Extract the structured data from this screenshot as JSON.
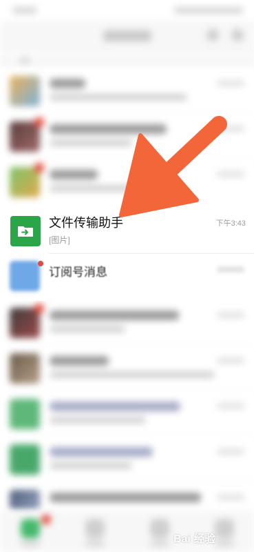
{
  "chat_list": {
    "highlighted_chat": {
      "name": "文件传输助手",
      "last_message": "[图片]",
      "time": "下午3:43",
      "icon": "folder-arrow-icon",
      "avatar_color": "#2aa548"
    },
    "subscription_row": {
      "name": "订阅号消息",
      "icon": "subscription-icon",
      "avatar_color": "#6fa8e6"
    }
  },
  "annotation": {
    "type": "arrow",
    "color": "#f2663a"
  },
  "watermark": {
    "text": "Bai 经验"
  }
}
